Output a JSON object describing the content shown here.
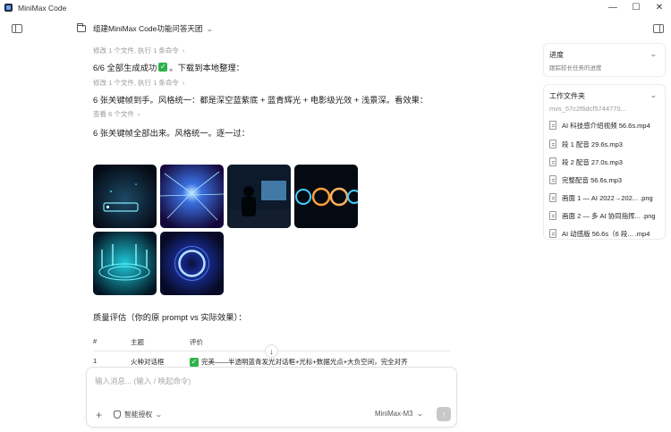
{
  "window": {
    "title": "MiniMax Code",
    "controls": [
      "—",
      "☐",
      "✕"
    ]
  },
  "header": {
    "title": "组建MiniMax Code功能问答天团"
  },
  "chat": {
    "meta1": "修改 1 个文件, 执行 1 条命令",
    "msg1_a": "6/6 全部生成成功",
    "msg1_b": "。下载到本地整理：",
    "meta2": "修改 1 个文件, 执行 1 条命令",
    "msg2": "6 张关键帧到手。风格统一：都是深空蓝紫底 + 蓝青辉光 + 电影级光效 + 浅景深。看效果：",
    "meta3": "查看 6 个文件",
    "msg3": "6 张关键帧全部出来。风格统一。逐一过：",
    "quality": "质量评估（你的原 prompt vs 实际效果）：",
    "table": {
      "headers": [
        "#",
        "主题",
        "评价"
      ],
      "rows": [
        {
          "num": "1",
          "topic": "火种对话框",
          "review": "完美——半透明蓝青发光对话框+光标+数据光点+大负空间，完全对齐"
        }
      ]
    }
  },
  "composer": {
    "placeholder": "输入消息... (输入 / 唤起命令)",
    "auth_label": "智能授权",
    "model_label": "MiniMax-M3"
  },
  "progress_panel": {
    "title": "进度",
    "subtitle": "跟踪较长任务的进度"
  },
  "files_panel": {
    "title": "工作文件夹",
    "path": "mvs_57c2f6dcf5744770...",
    "files": [
      "AI 科技感介绍视频 56.6s.mp4",
      "段 1 配音 29.6s.mp3",
      "段 2 配音 27.0s.mp3",
      "完整配音 56.6s.mp3",
      "画面 1 — AI 2022→202... .png",
      "画面 2 — 多 AI 协同指挥... .png",
      "AI 动感版 56.6s（6 段... .mp4"
    ]
  },
  "colors": {
    "accent_check": "#2fb34a",
    "send_disabled": "#c8c8c8"
  }
}
